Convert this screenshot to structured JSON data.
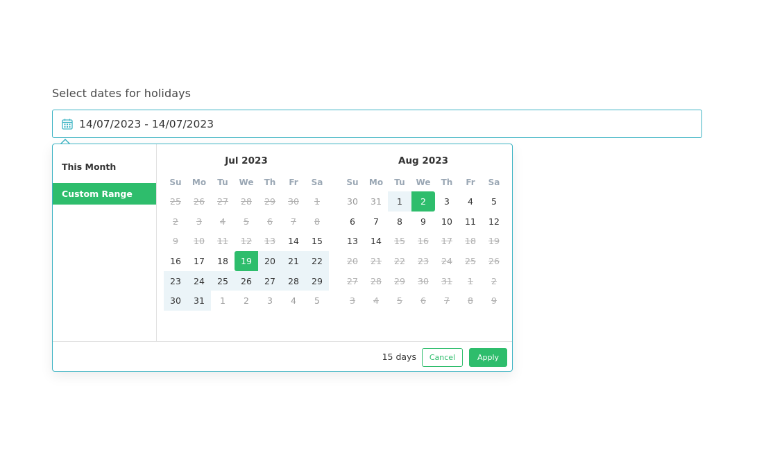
{
  "field": {
    "label": "Select dates for holidays",
    "value": "14/07/2023 - 14/07/2023",
    "icon": "calendar-icon"
  },
  "ranges": [
    {
      "label": "This Month",
      "active": false
    },
    {
      "label": "Custom Range",
      "active": true
    }
  ],
  "weekdays": [
    "Su",
    "Mo",
    "Tu",
    "We",
    "Th",
    "Fr",
    "Sa"
  ],
  "calendars": [
    {
      "title": "Jul 2023",
      "weeks": [
        [
          {
            "d": "25",
            "s": "dis"
          },
          {
            "d": "26",
            "s": "dis"
          },
          {
            "d": "27",
            "s": "dis"
          },
          {
            "d": "28",
            "s": "dis"
          },
          {
            "d": "29",
            "s": "dis"
          },
          {
            "d": "30",
            "s": "dis"
          },
          {
            "d": "1",
            "s": "dis"
          }
        ],
        [
          {
            "d": "2",
            "s": "dis"
          },
          {
            "d": "3",
            "s": "dis"
          },
          {
            "d": "4",
            "s": "dis"
          },
          {
            "d": "5",
            "s": "dis"
          },
          {
            "d": "6",
            "s": "dis"
          },
          {
            "d": "7",
            "s": "dis"
          },
          {
            "d": "8",
            "s": "dis"
          }
        ],
        [
          {
            "d": "9",
            "s": "dis"
          },
          {
            "d": "10",
            "s": "dis"
          },
          {
            "d": "11",
            "s": "dis"
          },
          {
            "d": "12",
            "s": "dis"
          },
          {
            "d": "13",
            "s": "dis"
          },
          {
            "d": "14",
            "s": ""
          },
          {
            "d": "15",
            "s": ""
          }
        ],
        [
          {
            "d": "16",
            "s": ""
          },
          {
            "d": "17",
            "s": ""
          },
          {
            "d": "18",
            "s": ""
          },
          {
            "d": "19",
            "s": "sel sel-start"
          },
          {
            "d": "20",
            "s": "in-range"
          },
          {
            "d": "21",
            "s": "in-range"
          },
          {
            "d": "22",
            "s": "in-range"
          }
        ],
        [
          {
            "d": "23",
            "s": "in-range"
          },
          {
            "d": "24",
            "s": "in-range"
          },
          {
            "d": "25",
            "s": "in-range"
          },
          {
            "d": "26",
            "s": "in-range"
          },
          {
            "d": "27",
            "s": "in-range"
          },
          {
            "d": "28",
            "s": "in-range"
          },
          {
            "d": "29",
            "s": "in-range"
          }
        ],
        [
          {
            "d": "30",
            "s": "in-range"
          },
          {
            "d": "31",
            "s": "in-range"
          },
          {
            "d": "1",
            "s": "off"
          },
          {
            "d": "2",
            "s": "off"
          },
          {
            "d": "3",
            "s": "off"
          },
          {
            "d": "4",
            "s": "off"
          },
          {
            "d": "5",
            "s": "off"
          }
        ]
      ]
    },
    {
      "title": "Aug 2023",
      "weeks": [
        [
          {
            "d": "30",
            "s": "off"
          },
          {
            "d": "31",
            "s": "off"
          },
          {
            "d": "1",
            "s": "in-range"
          },
          {
            "d": "2",
            "s": "sel sel-end"
          },
          {
            "d": "3",
            "s": ""
          },
          {
            "d": "4",
            "s": ""
          },
          {
            "d": "5",
            "s": ""
          }
        ],
        [
          {
            "d": "6",
            "s": ""
          },
          {
            "d": "7",
            "s": ""
          },
          {
            "d": "8",
            "s": ""
          },
          {
            "d": "9",
            "s": ""
          },
          {
            "d": "10",
            "s": ""
          },
          {
            "d": "11",
            "s": ""
          },
          {
            "d": "12",
            "s": ""
          }
        ],
        [
          {
            "d": "13",
            "s": ""
          },
          {
            "d": "14",
            "s": ""
          },
          {
            "d": "15",
            "s": "dis"
          },
          {
            "d": "16",
            "s": "dis"
          },
          {
            "d": "17",
            "s": "dis"
          },
          {
            "d": "18",
            "s": "dis"
          },
          {
            "d": "19",
            "s": "dis"
          }
        ],
        [
          {
            "d": "20",
            "s": "dis"
          },
          {
            "d": "21",
            "s": "dis"
          },
          {
            "d": "22",
            "s": "dis"
          },
          {
            "d": "23",
            "s": "dis"
          },
          {
            "d": "24",
            "s": "dis"
          },
          {
            "d": "25",
            "s": "dis"
          },
          {
            "d": "26",
            "s": "dis"
          }
        ],
        [
          {
            "d": "27",
            "s": "dis"
          },
          {
            "d": "28",
            "s": "dis"
          },
          {
            "d": "29",
            "s": "dis"
          },
          {
            "d": "30",
            "s": "dis"
          },
          {
            "d": "31",
            "s": "dis"
          },
          {
            "d": "1",
            "s": "dis"
          },
          {
            "d": "2",
            "s": "dis"
          }
        ],
        [
          {
            "d": "3",
            "s": "dis"
          },
          {
            "d": "4",
            "s": "dis"
          },
          {
            "d": "5",
            "s": "dis"
          },
          {
            "d": "6",
            "s": "dis"
          },
          {
            "d": "7",
            "s": "dis"
          },
          {
            "d": "8",
            "s": "dis"
          },
          {
            "d": "9",
            "s": "dis"
          }
        ]
      ]
    }
  ],
  "footer": {
    "days": "15 days",
    "cancel_label": "Cancel",
    "apply_label": "Apply"
  },
  "colors": {
    "accent": "#2ebd6c",
    "border": "#3bb3c3",
    "range_bg": "#ebf4f8"
  }
}
